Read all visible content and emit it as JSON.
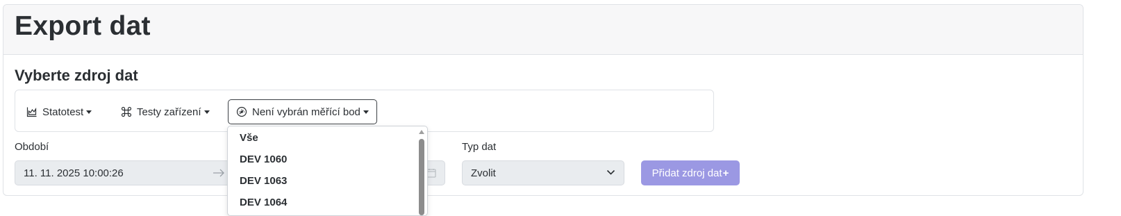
{
  "header": {
    "title": "Export dat"
  },
  "source": {
    "title": "Vyberte zdroj dat",
    "station_button": "Statotest",
    "tests_button": "Testy zařízení",
    "point_button": "Není vybrán měřící bod"
  },
  "period": {
    "label": "Období",
    "start": "11. 11. 2025 10:00:26"
  },
  "data_type": {
    "label": "Typ dat",
    "value": "Zvolit"
  },
  "add_button": {
    "label": "Přidat zdroj dat",
    "plus": "+"
  },
  "dropdown": {
    "items": [
      "Vše",
      "DEV 1060",
      "DEV 1063",
      "DEV 1064"
    ]
  },
  "colors": {
    "accent": "#9b98e3",
    "header_bg": "#f7f7f8",
    "input_bg": "#e9ecef"
  },
  "icons": {
    "station": "chart-icon",
    "tests": "command-icon",
    "point": "gauge-icon",
    "arrow": "arrow-right-icon",
    "calendar": "calendar-icon",
    "select": "chevron-down-icon"
  }
}
